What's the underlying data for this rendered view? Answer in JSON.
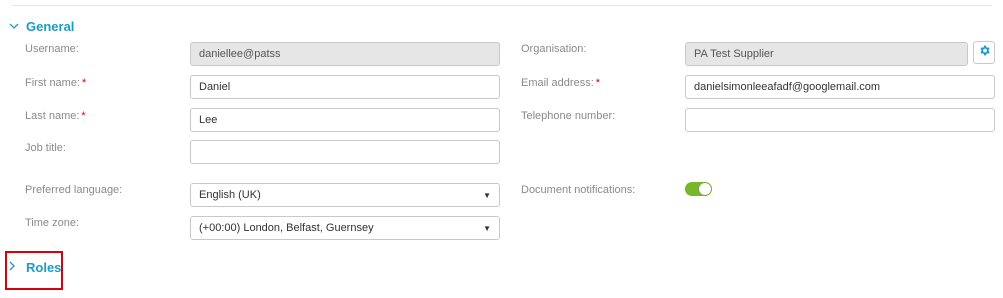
{
  "sections": {
    "general": {
      "title": "General",
      "expanded": true
    },
    "roles": {
      "title": "Roles",
      "expanded": false
    }
  },
  "fields": {
    "username": {
      "label": "Username:",
      "value": "daniellee@patss"
    },
    "first_name": {
      "label": "First name:",
      "value": "Daniel",
      "required_mark": "*"
    },
    "last_name": {
      "label": "Last name:",
      "value": "Lee",
      "required_mark": "*"
    },
    "job_title": {
      "label": "Job title:",
      "value": ""
    },
    "preferred_language": {
      "label": "Preferred language:",
      "value": "English (UK)"
    },
    "time_zone": {
      "label": "Time zone:",
      "value": "(+00:00) London, Belfast, Guernsey"
    },
    "organisation": {
      "label": "Organisation:",
      "value": "PA Test Supplier"
    },
    "email": {
      "label": "Email address:",
      "value": "danielsimonleeafadf@googlemail.com",
      "required_mark": "*"
    },
    "telephone": {
      "label": "Telephone number:",
      "value": ""
    },
    "document_notifications": {
      "label": "Document notifications:",
      "enabled": true
    }
  },
  "icons": {
    "section_expanded": "chevron-down-icon",
    "section_collapsed": "chevron-right-icon",
    "organisation_settings": "gear-icon",
    "dropdown": "caret-down-icon"
  },
  "colors": {
    "accent": "#1b9bc7",
    "required": "#d9000b",
    "toggle_on": "#7ab62a",
    "highlight_box": "#d9000b"
  }
}
